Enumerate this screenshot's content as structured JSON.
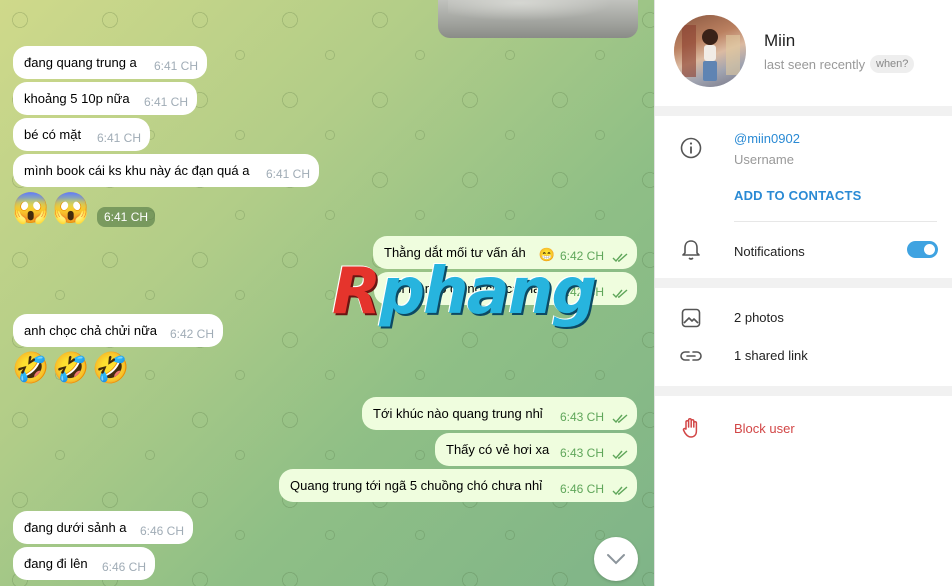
{
  "chat": {
    "incoming": [
      {
        "text": "đang quang trung a",
        "time": "6:41 CH"
      },
      {
        "text": "khoảng 5 10p nữa",
        "time": "6:41 CH"
      },
      {
        "text": "bé có mặt",
        "time": "6:41 CH"
      },
      {
        "text": "mình book cái ks khu này ác đạn quá a",
        "time": "6:41 CH"
      },
      {
        "text": "anh chọc chả chửi nữa",
        "time": "6:42 CH"
      },
      {
        "text": "đang dưới sảnh a",
        "time": "6:46 CH"
      },
      {
        "text": "đang đi lên",
        "time": "6:46 CH"
      }
    ],
    "outgoing": [
      {
        "text": "Thằng dắt mối tư vấn áh",
        "emoji": "😁",
        "time": "6:42 CH"
      },
      {
        "text": "Hỏi ks nào dc nó chỉ cái này",
        "time": "6:42 CH"
      },
      {
        "text": "Tới khúc nào quang trung nhỉ",
        "time": "6:43 CH"
      },
      {
        "text": "Thấy có vẻ hơi xa",
        "time": "6:43 CH"
      },
      {
        "text": "Quang trung tới ngã 5 chuồng chó chưa nhỉ",
        "time": "6:46 CH"
      }
    ],
    "emoji_messages": [
      {
        "emojis": [
          "😱",
          "😱"
        ],
        "time": "6:41 CH"
      },
      {
        "emojis": [
          "🤣",
          "🤣",
          "🤣"
        ]
      }
    ],
    "watermark": {
      "part1": "R",
      "part2": "phang"
    }
  },
  "profile": {
    "name": "Miin",
    "status": "last seen recently",
    "when_button": "when?",
    "username": "@miin0902",
    "username_label": "Username",
    "add_contacts": "ADD TO CONTACTS",
    "notifications_label": "Notifications",
    "notifications_on": true,
    "photos": "2 photos",
    "shared_links": "1 shared link",
    "block": "Block user"
  },
  "colors": {
    "accent": "#2a8ad4",
    "toggle": "#3fa3e1",
    "danger": "#d24646",
    "outgoing_bubble": "#effdde"
  }
}
